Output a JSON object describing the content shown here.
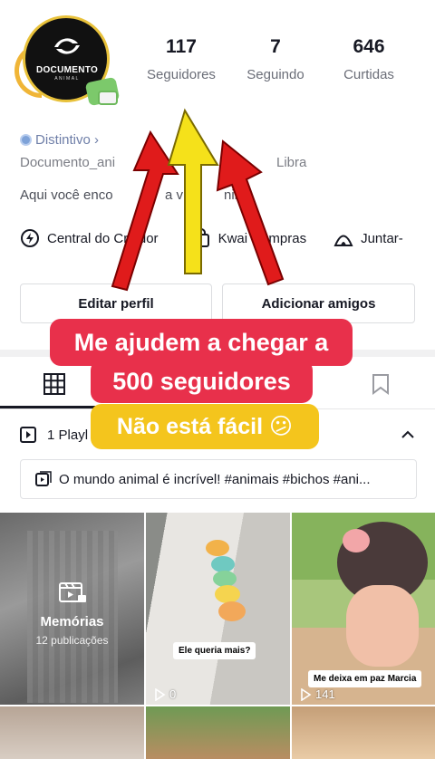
{
  "profile": {
    "avatar_brand": "DOCUMENTO",
    "avatar_sub": "ANIMAL",
    "stats": [
      {
        "value": "117",
        "label": "Seguidores"
      },
      {
        "value": "7",
        "label": "Seguindo"
      },
      {
        "value": "646",
        "label": "Curtidas"
      }
    ],
    "tag_label": "Distintivo ›",
    "handle_text": "Documento_ani",
    "sign_text": "Libra",
    "bio_text": "Aqui você enco",
    "bio_text2": "a vida",
    "bio_text3": "nim"
  },
  "links": [
    {
      "icon": "lightning-icon",
      "label": "Central do Criador"
    },
    {
      "icon": "bag-icon",
      "label": "Kwai Compras"
    },
    {
      "icon": "tent-icon",
      "label": "Juntar-"
    }
  ],
  "buttons": {
    "edit": "Editar perfil",
    "add_friends": "Adicionar amigos"
  },
  "overlay": {
    "line1": "Me ajudem a chegar a",
    "line2": "500 seguidores",
    "line3": "Não está fácil 😕",
    "red": "#e8304b",
    "yellow": "#f4c51d"
  },
  "playlist": {
    "count_label": "1 Playl",
    "item": "O mundo animal é incrível! #animais #bichos #ani..."
  },
  "grid": [
    {
      "title": "Memórias",
      "subtitle": "12 publicações"
    },
    {
      "caption": "Ele queria mais?",
      "plays": "0"
    },
    {
      "caption": "Me deixa em paz Marcia",
      "plays": "141"
    }
  ]
}
